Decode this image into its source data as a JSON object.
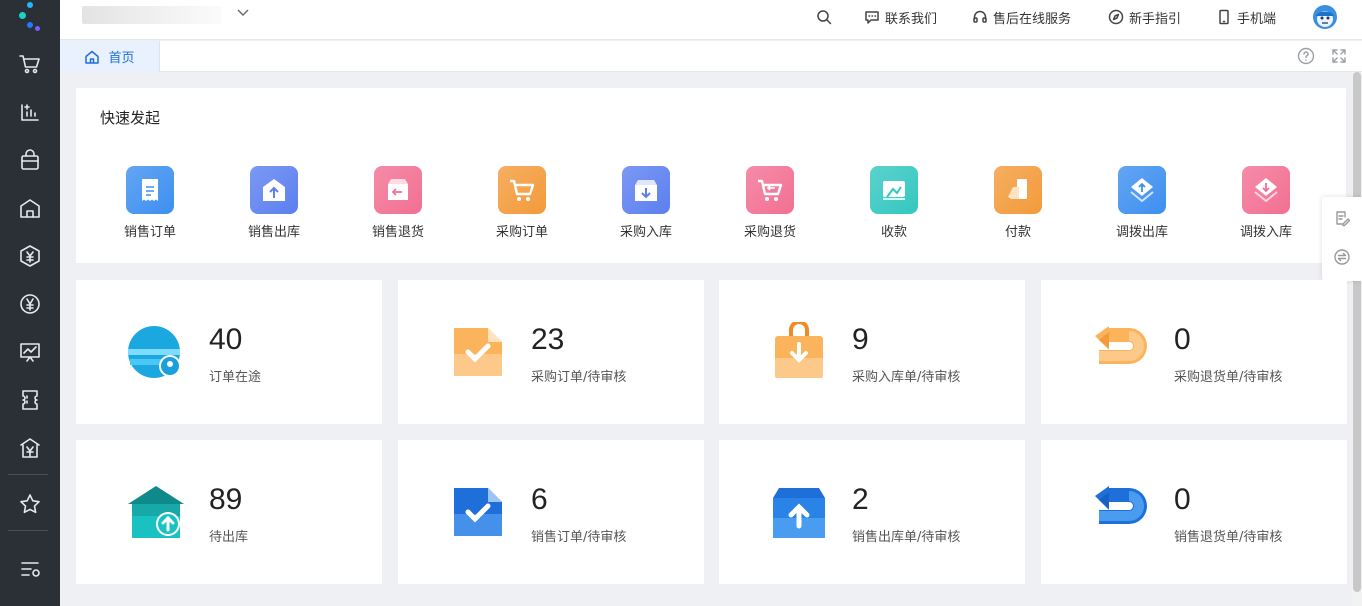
{
  "header": {
    "company_name": "",
    "contact": "联系我们",
    "service": "售后在线服务",
    "guide": "新手指引",
    "mobile": "手机端"
  },
  "tabs": {
    "home": "首页"
  },
  "sidebar": {
    "items": [
      "cart-icon",
      "report-icon",
      "bag-icon",
      "warehouse-icon",
      "finance-icon",
      "yuan-icon",
      "monitor-icon",
      "ticket-icon",
      "bank-icon",
      "star-icon",
      "settings-list-icon"
    ]
  },
  "quick": {
    "title": "快速发起",
    "items": [
      {
        "label": "销售订单",
        "color": "#3d8ff0"
      },
      {
        "label": "销售出库",
        "color": "#5b7ff0"
      },
      {
        "label": "销售退货",
        "color": "#f26f93"
      },
      {
        "label": "采购订单",
        "color": "#f39a3a"
      },
      {
        "label": "采购入库",
        "color": "#5b7ff0"
      },
      {
        "label": "采购退货",
        "color": "#f26f93"
      },
      {
        "label": "收款",
        "color": "#33c7c0"
      },
      {
        "label": "付款",
        "color": "#f39a3a"
      },
      {
        "label": "调拨出库",
        "color": "#3d8ff0"
      },
      {
        "label": "调拨入库",
        "color": "#f26f93"
      }
    ]
  },
  "stats": [
    {
      "value": "40",
      "label": "订单在途"
    },
    {
      "value": "23",
      "label": "采购订单/待审核"
    },
    {
      "value": "9",
      "label": "采购入库单/待审核"
    },
    {
      "value": "0",
      "label": "采购退货单/待审核"
    },
    {
      "value": "89",
      "label": "待出库"
    },
    {
      "value": "6",
      "label": "销售订单/待审核"
    },
    {
      "value": "2",
      "label": "销售出库单/待审核"
    },
    {
      "value": "0",
      "label": "销售退货单/待审核"
    }
  ]
}
